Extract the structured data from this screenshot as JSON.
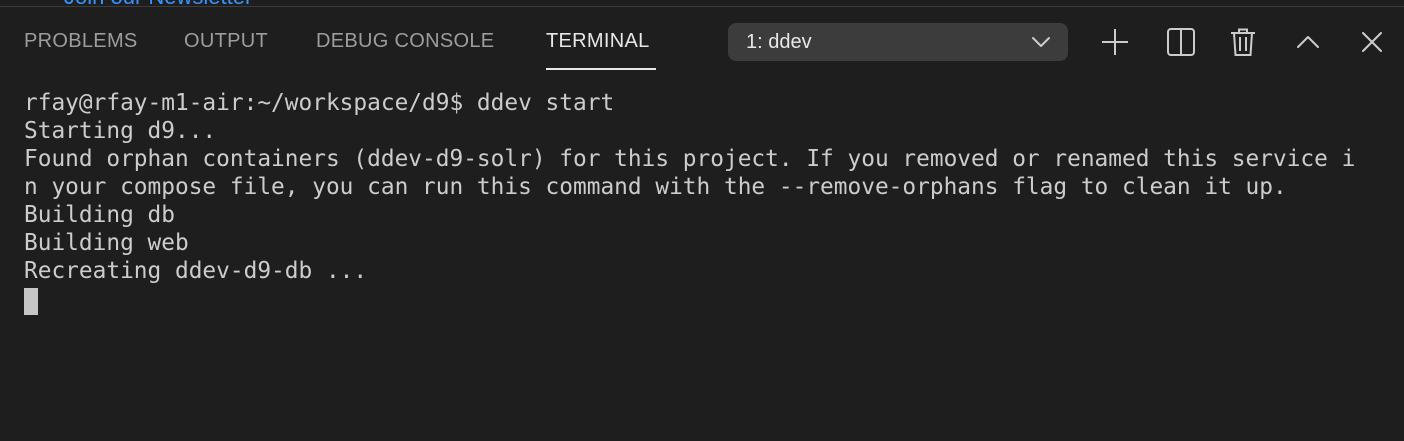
{
  "editor_remnant": {
    "link_text": "Join our Newsletter"
  },
  "panel": {
    "tabs": [
      {
        "label": "PROBLEMS",
        "active": false
      },
      {
        "label": "OUTPUT",
        "active": false
      },
      {
        "label": "DEBUG CONSOLE",
        "active": false
      },
      {
        "label": "TERMINAL",
        "active": true
      }
    ],
    "terminal_select": {
      "value": "1: ddev"
    },
    "actions": [
      {
        "name": "new-terminal",
        "icon": "plus-icon"
      },
      {
        "name": "split-terminal",
        "icon": "split-icon"
      },
      {
        "name": "kill-terminal",
        "icon": "trash-icon"
      },
      {
        "name": "maximize-panel",
        "icon": "chevron-up-icon"
      },
      {
        "name": "close-panel",
        "icon": "close-icon"
      }
    ]
  },
  "terminal": {
    "lines": [
      "rfay@rfay-m1-air:~/workspace/d9$ ddev start",
      "Starting d9...",
      "Found orphan containers (ddev-d9-solr) for this project. If you removed or renamed this service i",
      "n your compose file, you can run this command with the --remove-orphans flag to clean it up.",
      "Building db",
      "Building web",
      "Recreating ddev-d9-db ..."
    ]
  },
  "colors": {
    "background": "#1e1e1e",
    "tab_inactive": "#9d9d9d",
    "tab_active": "#e7e7e7",
    "select_bg": "#3c3c3c",
    "terminal_text": "#cccccc",
    "link": "#3794ff"
  }
}
